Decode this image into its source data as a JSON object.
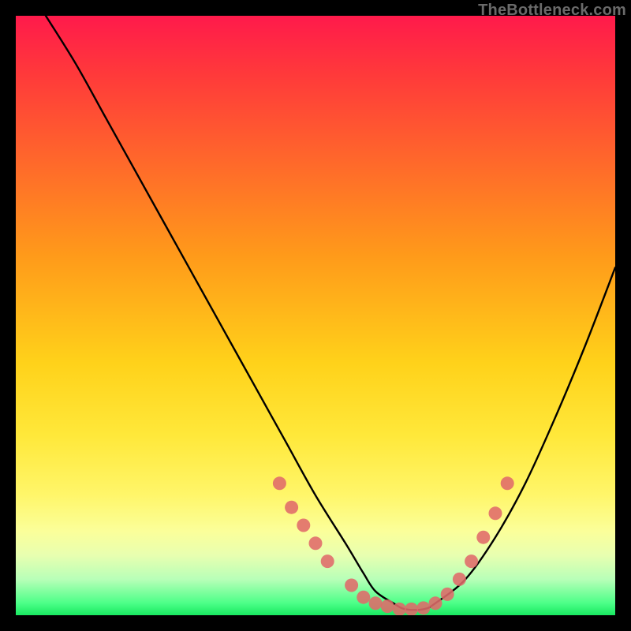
{
  "watermark": "TheBottleneck.com",
  "colors": {
    "frame": "#000000",
    "gradient_top": "#ff1a4b",
    "gradient_mid": "#ffe23a",
    "gradient_bottom": "#18e860",
    "curve": "#000000",
    "scatter": "#e06a6a"
  },
  "chart_data": {
    "type": "line",
    "title": "",
    "xlabel": "",
    "ylabel": "",
    "xlim": [
      0,
      100
    ],
    "ylim": [
      0,
      100
    ],
    "series": [
      {
        "name": "curve",
        "x": [
          5,
          10,
          15,
          20,
          25,
          30,
          35,
          40,
          45,
          50,
          55,
          58,
          60,
          63,
          65,
          68,
          70,
          75,
          80,
          85,
          90,
          95,
          100
        ],
        "y": [
          100,
          92,
          83,
          74,
          65,
          56,
          47,
          38,
          29,
          20,
          12,
          7,
          4,
          2,
          1,
          1,
          2,
          6,
          13,
          22,
          33,
          45,
          58
        ]
      }
    ],
    "scatter": {
      "name": "highlighted-points",
      "x": [
        44,
        46,
        48,
        50,
        52,
        56,
        58,
        60,
        62,
        64,
        66,
        68,
        70,
        72,
        74,
        76,
        78,
        80,
        82
      ],
      "y": [
        22,
        18,
        15,
        12,
        9,
        5,
        3,
        2,
        1.5,
        1,
        1,
        1.2,
        2,
        3.5,
        6,
        9,
        13,
        17,
        22
      ]
    }
  }
}
